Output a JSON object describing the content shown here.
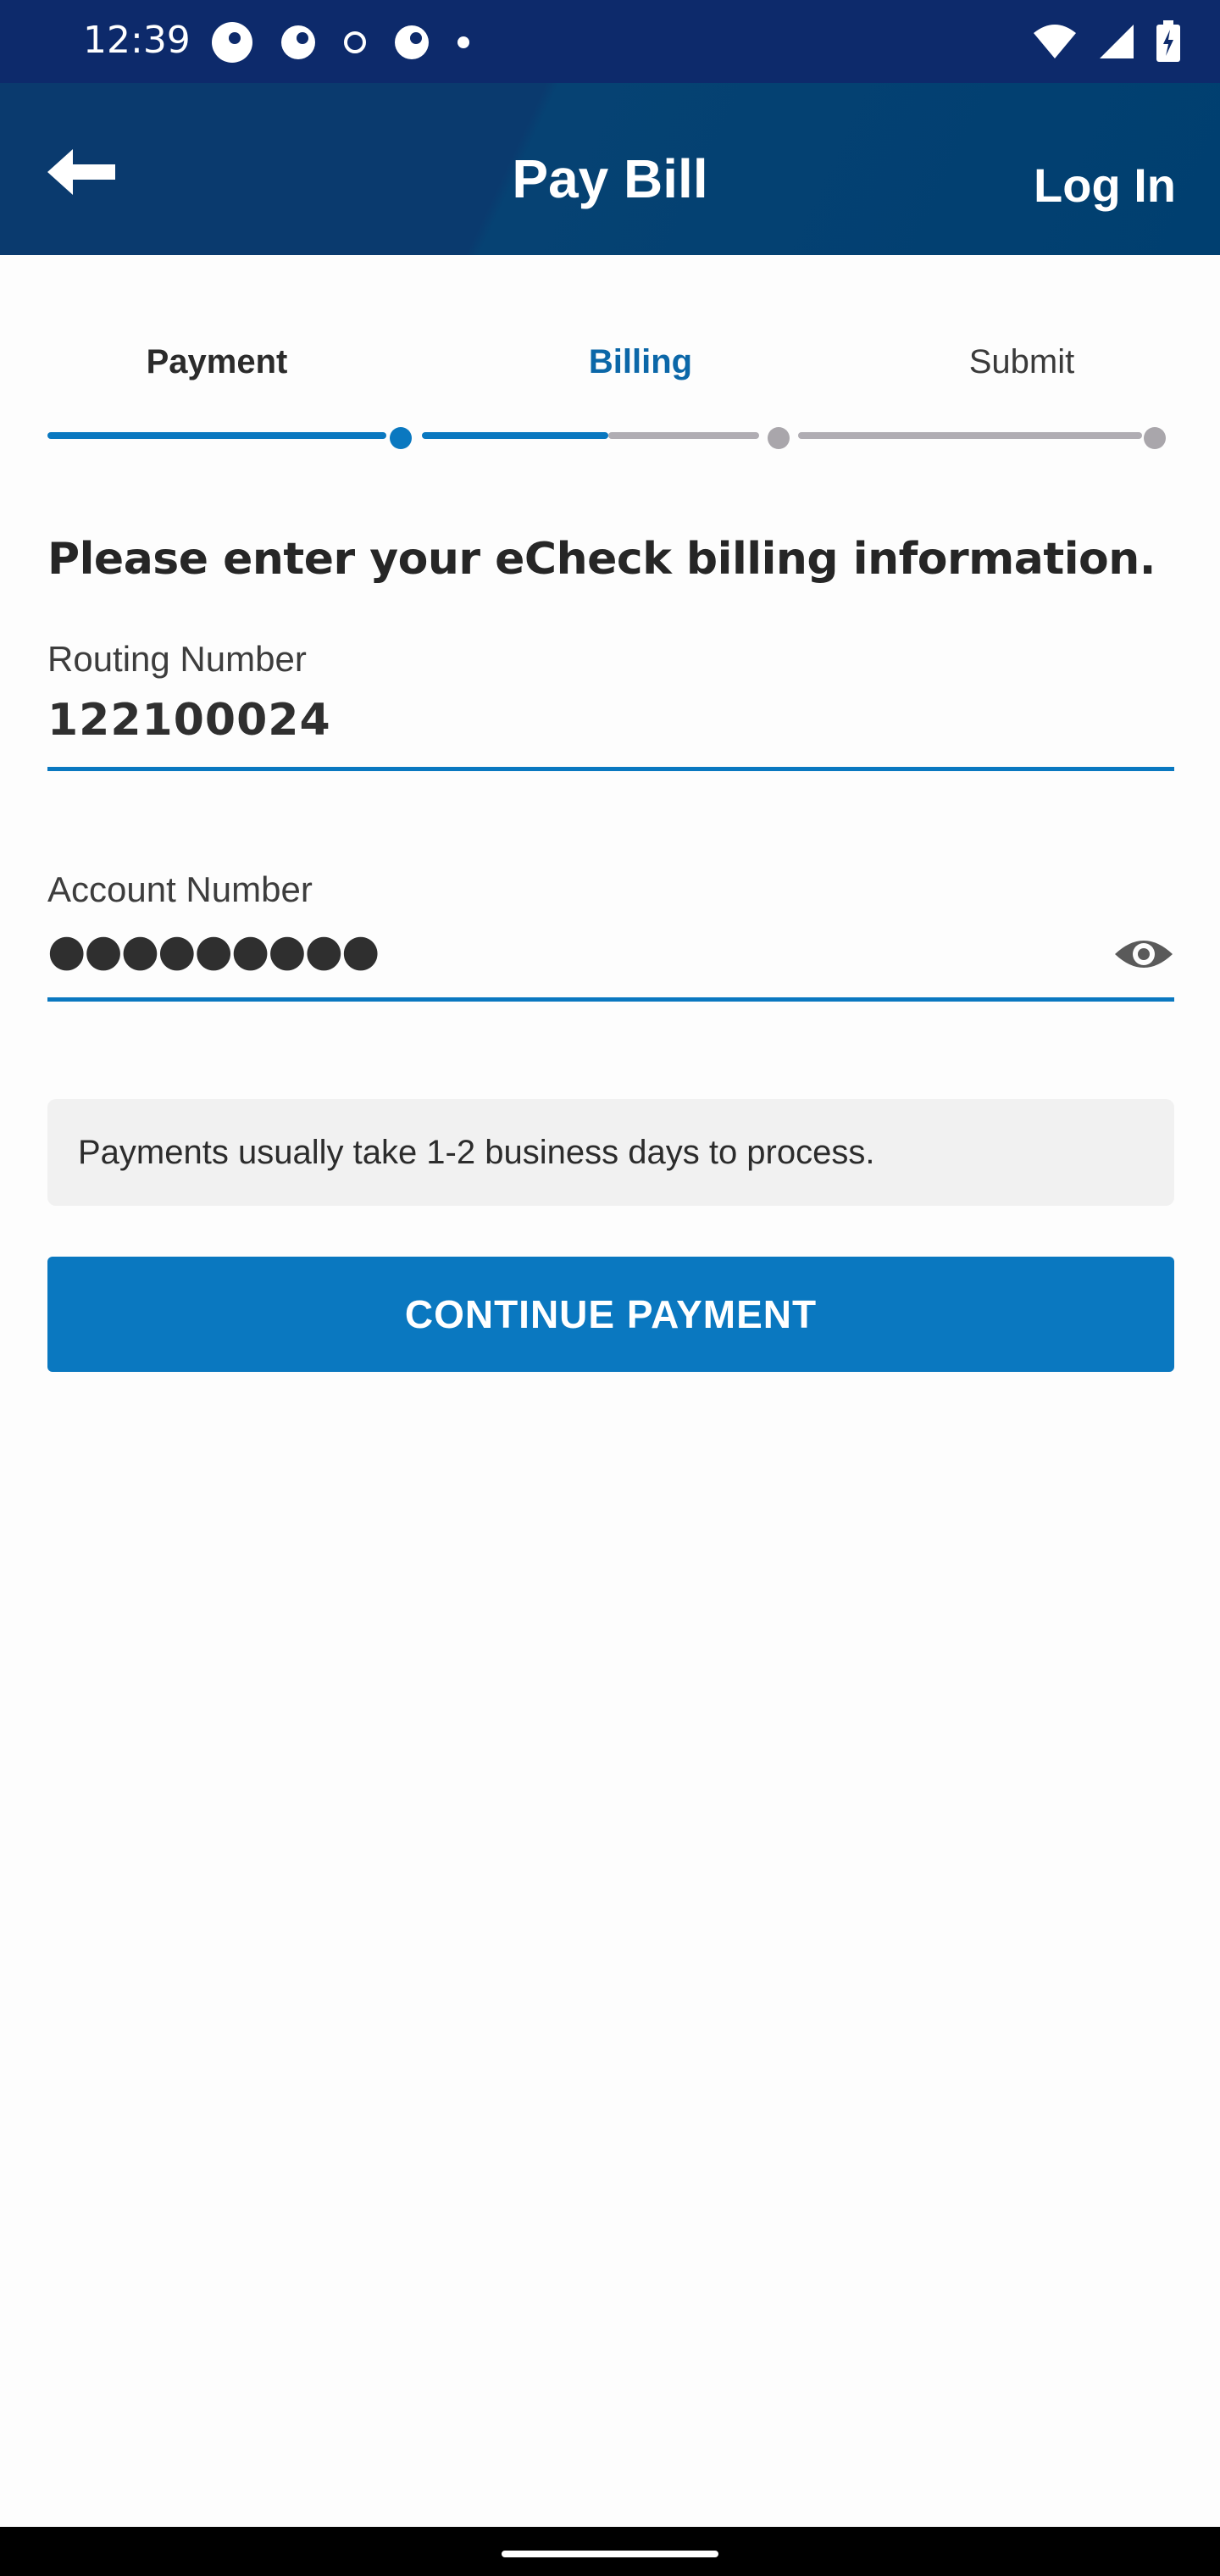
{
  "status_bar": {
    "time": "12:39",
    "icons_left": [
      "app-notification-icon",
      "app-notification-icon",
      "small-dot-icon",
      "app-notification-icon",
      "dot-icon"
    ],
    "icons_right": [
      "wifi-icon",
      "signal-icon",
      "battery-charging-icon"
    ]
  },
  "app_bar": {
    "title": "Pay Bill",
    "login_label": "Log In",
    "back_icon": "arrow-left-icon"
  },
  "steps": [
    {
      "label": "Payment",
      "state": "completed"
    },
    {
      "label": "Billing",
      "state": "active"
    },
    {
      "label": "Submit",
      "state": "pending"
    }
  ],
  "progress": {
    "fraction": 0.5
  },
  "form": {
    "heading": "Please enter your eCheck billing information.",
    "routing": {
      "label": "Routing Number",
      "value": "122100024"
    },
    "account": {
      "label": "Account Number",
      "value": "●●●●●●●●●",
      "toggle_icon": "eye-icon"
    }
  },
  "info_text": "Payments usually take 1-2 business days to process.",
  "continue_label": "CONTINUE PAYMENT",
  "colors": {
    "status_bar": "#0d2a6b",
    "app_bar": "#003f70",
    "accent": "#0a78c0",
    "active_step": "#0b67a8",
    "inactive_track": "#b0adb3"
  }
}
